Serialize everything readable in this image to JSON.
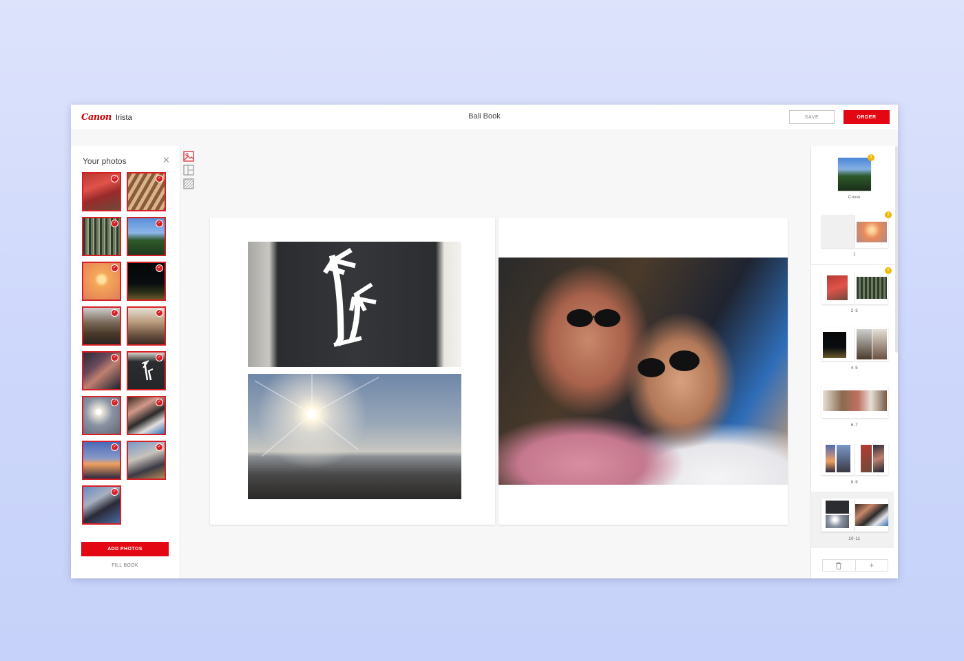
{
  "header": {
    "brand": "Canon",
    "product": "Irista",
    "title": "Bali Book",
    "save_label": "SAVE",
    "order_label": "ORDER"
  },
  "photos_panel": {
    "title": "Your photos",
    "close_icon": "close-icon",
    "add_label": "ADD PHOTOS",
    "fill_label": "FILL BOOK",
    "photo_count": 13
  },
  "tools": [
    "image-icon",
    "layout-icon",
    "background-pattern-icon"
  ],
  "spreads": [
    {
      "label": "Cover",
      "warning": true
    },
    {
      "label": "1",
      "warning": true
    },
    {
      "label": "2-3",
      "warning": true
    },
    {
      "label": "4-5",
      "warning": false
    },
    {
      "label": "6-7",
      "warning": false
    },
    {
      "label": "8-9",
      "warning": false
    },
    {
      "label": "10-11",
      "warning": false,
      "active": true
    }
  ],
  "rail_actions": {
    "delete_icon": "trash-icon",
    "add_icon": "plus-icon"
  },
  "colors": {
    "accent": "#e30613",
    "warning": "#f2b705"
  }
}
